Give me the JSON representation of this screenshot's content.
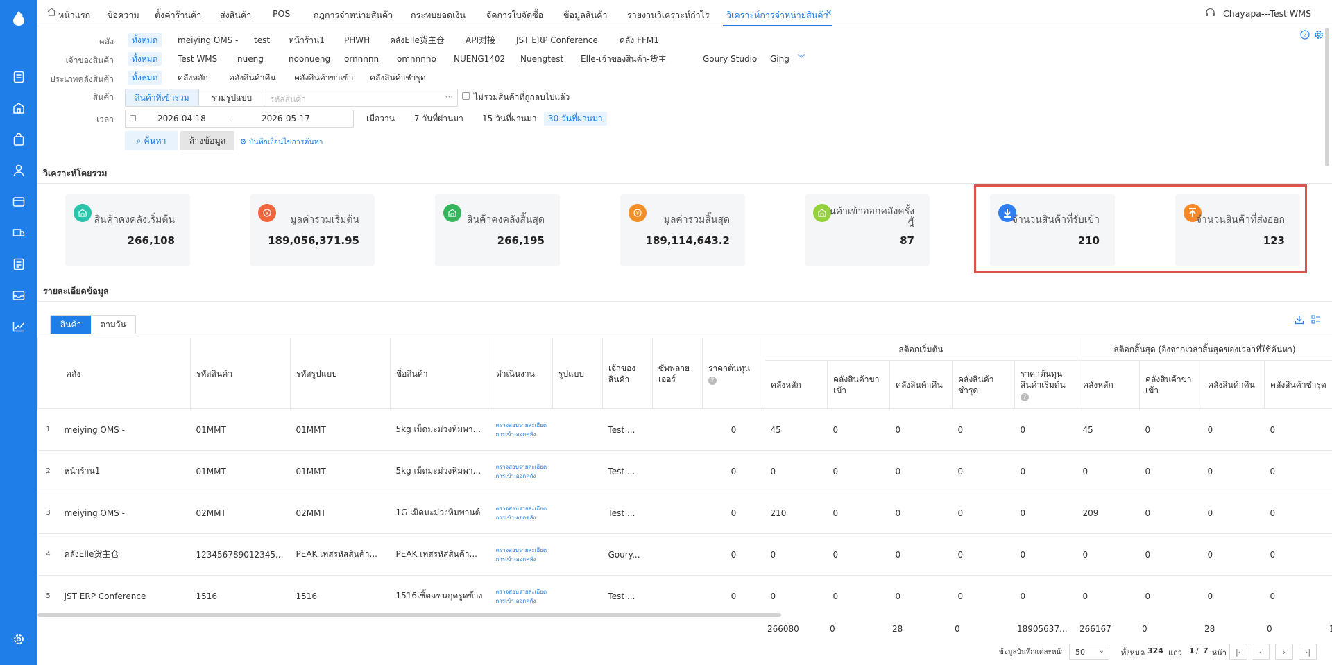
{
  "sidebar": {
    "icons": [
      "logo-drop-icon",
      "document-icon",
      "store-icon",
      "bag-icon",
      "user-icon",
      "wallet-icon",
      "truck-icon",
      "checklist-icon",
      "inbox-icon",
      "trend-chart-icon",
      "settings-icon"
    ]
  },
  "tabs": [
    {
      "label": "หน้าแรก",
      "active": false
    },
    {
      "label": "ข้อความ",
      "active": false
    },
    {
      "label": "ตั้งค่าร้านค้า",
      "active": false
    },
    {
      "label": "ส่งสินค้า",
      "active": false
    },
    {
      "label": "POS",
      "active": false
    },
    {
      "label": "กฎการจำหน่ายสินค้า",
      "active": false
    },
    {
      "label": "กระทบยอดเงิน",
      "active": false
    },
    {
      "label": "จัดการใบจัดซื้อ",
      "active": false
    },
    {
      "label": "ข้อมูลสินค้า",
      "active": false
    },
    {
      "label": "รายงานวิเคราะห์กำไร",
      "active": false
    },
    {
      "label": "วิเคราะห์การจำหน่ายสินค้า",
      "active": true
    }
  ],
  "user": "Chayapa---Test WMS",
  "filters": {
    "warehouse": {
      "label": "คลัง",
      "options": [
        "ทั้งหมด",
        "meiying OMS -",
        "test",
        "หน้าร้าน1",
        "PHWH",
        "คลังElle货主仓",
        "API对接",
        "JST ERP Conference",
        "คลัง FFM1"
      ]
    },
    "owner": {
      "label": "เจ้าของสินค้า",
      "options": [
        "ทั้งหมด",
        "Test WMS",
        "nueng",
        "noonueng",
        "ornnnnn",
        "omnnnno",
        "NUENG1402",
        "Nuengtest",
        "Elle-เจ้าของสินค้า-货主",
        "Goury Studio",
        "Ging"
      ]
    },
    "wtype": {
      "label": "ประเภทคลังสินค้า",
      "options": [
        "ทั้งหมด",
        "คลังหลัก",
        "คลังสินค้าคืน",
        "คลังสินค้าขาเข้า",
        "คลังสินค้าชำรุด"
      ]
    },
    "product": {
      "label": "สินค้า",
      "seg1": "สินค้าที่เข้าร่วม",
      "seg2": "รวมรูปแบบ",
      "placeholder": "รหัสสินค้า",
      "dots": "···",
      "exclude": "ไม่รวมสินค้าที่ถูกลบไปแล้ว"
    },
    "time": {
      "label": "เวลา",
      "start": "2026-04-18",
      "dash": "-",
      "end": "2026-05-17",
      "quick": [
        "เมื่อวาน",
        "7 วันที่ผ่านมา",
        "15 วันที่ผ่านมา",
        "30 วันที่ผ่านมา"
      ]
    },
    "search": "ค้นหา",
    "clear": "ล้างข้อมูล",
    "save": "บันทึกเงื่อนไขการค้นหา"
  },
  "overview_title": "วิเคราะห์โดยรวม",
  "cards": [
    {
      "title": "สินค้าคงคลังเริ่มต้น",
      "value": "266,108",
      "color": "#29c4a9",
      "icon": "warehouse-icon"
    },
    {
      "title": "มูลค่ารวมเริ่มต้น",
      "value": "189,056,371.95",
      "color": "#f0663d",
      "icon": "coin-icon"
    },
    {
      "title": "สินค้าคงคลังสิ้นสุด",
      "value": "266,195",
      "color": "#34b55b",
      "icon": "warehouse-icon"
    },
    {
      "title": "มูลค่ารวมสิ้นสุด",
      "value": "189,114,643.2",
      "color": "#f0902a",
      "icon": "coin-icon"
    },
    {
      "title": "นค้าเข้าออกคลังครั้ง นี้",
      "value": "87",
      "color": "#95d13a",
      "icon": "warehouse-icon"
    },
    {
      "title": "จำนวนสินค้าที่รับเข้า",
      "value": "210",
      "color": "#2f7ef0",
      "icon": "download-icon"
    },
    {
      "title": "จำนวนสินค้าที่ส่งออก",
      "value": "123",
      "color": "#f5892a",
      "icon": "upload-icon"
    }
  ],
  "detail_title": "รายละเอียดข้อมูล",
  "view_tabs": [
    "สินค้า",
    "ตามวัน"
  ],
  "table": {
    "headers": {
      "warehouse": "คลัง",
      "sku": "รหัสสินค้า",
      "style_code": "รหัสรูปแบบ",
      "name": "ชื่อสินค้า",
      "op": "ดำเนินงาน",
      "style": "รูปแบบ",
      "owner": "เจ้าของ สินค้า",
      "supplier": "ซัพพลายเออร์",
      "cost": "ราคาต้นทุน",
      "start_group": "สต็อกเริ่มต้น",
      "end_group": "สต็อกสิ้นสุด (อิงจากเวลาสิ้นสุดของเวลาที่ใช้ค้นหา)",
      "main": "คลังหลัก",
      "inbound": "คลังสินค้าขาเข้า",
      "returns": "คลังสินค้าคืน",
      "damaged": "คลังสินค้าชำรุด",
      "start_cost": "ราคาต้นทุนสินค้าเริ่มต้น"
    },
    "rows": [
      {
        "idx": "1",
        "warehouse": "meiying OMS -",
        "sku": "01MMT",
        "style_code": "01MMT",
        "name": "5kg เม็ดมะม่วงหิมพา...",
        "op": "ตรวจสอบรายละเอียดการเข้า-ออกคลัง",
        "style": "",
        "owner": "Test ...",
        "supplier": "",
        "cost": "0",
        "s_main": "45",
        "s_in": "0",
        "s_ret": "0",
        "s_dmg": "0",
        "s_cost": "0",
        "e_main": "45",
        "e_in": "0",
        "e_ret": "0",
        "e_dmg": "0"
      },
      {
        "idx": "2",
        "warehouse": "หน้าร้าน1",
        "sku": "01MMT",
        "style_code": "01MMT",
        "name": "5kg เม็ดมะม่วงหิมพา...",
        "op": "ตรวจสอบรายละเอียดการเข้า-ออกคลัง",
        "style": "",
        "owner": "Test ...",
        "supplier": "",
        "cost": "0",
        "s_main": "0",
        "s_in": "0",
        "s_ret": "0",
        "s_dmg": "0",
        "s_cost": "0",
        "e_main": "0",
        "e_in": "0",
        "e_ret": "0",
        "e_dmg": "0"
      },
      {
        "idx": "3",
        "warehouse": "meiying OMS -",
        "sku": "02MMT",
        "style_code": "02MMT",
        "name": "1G เม็ดมะม่วงหิมพานต์",
        "op": "ตรวจสอบรายละเอียดการเข้า-ออกคลัง",
        "style": "",
        "owner": "Test ...",
        "supplier": "",
        "cost": "0",
        "s_main": "210",
        "s_in": "0",
        "s_ret": "0",
        "s_dmg": "0",
        "s_cost": "0",
        "e_main": "209",
        "e_in": "0",
        "e_ret": "0",
        "e_dmg": "0"
      },
      {
        "idx": "4",
        "warehouse": "คลังElle货主仓",
        "sku": "123456789012345...",
        "style_code": "PEAK เทสรหัสสินค้า...",
        "name": "PEAK เทสรหัสสินค้า...",
        "op": "ตรวจสอบรายละเอียดการเข้า-ออกคลัง",
        "style": "",
        "owner": "Goury...",
        "supplier": "",
        "cost": "0",
        "s_main": "0",
        "s_in": "0",
        "s_ret": "0",
        "s_dmg": "0",
        "s_cost": "0",
        "e_main": "0",
        "e_in": "0",
        "e_ret": "0",
        "e_dmg": "0"
      },
      {
        "idx": "5",
        "warehouse": "JST ERP Conference",
        "sku": "1516",
        "style_code": "1516",
        "name": "1516เชิ้ตแขนกุดรูดข้าง",
        "op": "ตรวจสอบรายละเอียดการเข้า-ออกคลัง",
        "style": "",
        "owner": "Test ...",
        "supplier": "",
        "cost": "0",
        "s_main": "0",
        "s_in": "0",
        "s_ret": "0",
        "s_dmg": "0",
        "s_cost": "0",
        "e_main": "0",
        "e_in": "0",
        "e_ret": "0",
        "e_dmg": "0"
      }
    ],
    "totals": [
      "266080",
      "0",
      "28",
      "0",
      "18905637...",
      "266167",
      "0",
      "28",
      "0",
      "1"
    ]
  },
  "pagination": {
    "per_page_label": "ข้อมูลบันทึกแต่ละหน้า",
    "per_page": "50",
    "total_label": "ทั้งหมด",
    "total": "324",
    "unit": "แถว",
    "page": "1",
    "sep": "/",
    "pages": "7",
    "page_unit": "หน้า"
  }
}
